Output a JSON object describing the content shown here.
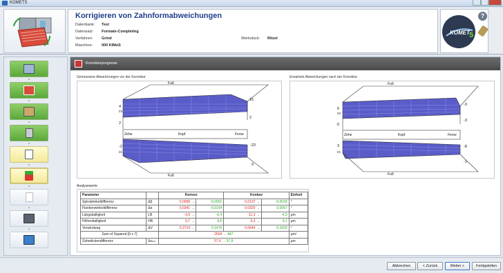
{
  "app": {
    "title": "KOMETS"
  },
  "header": {
    "title": "Korrigieren von Zahnformabweichungen",
    "rows": [
      {
        "label": "Datenbank:",
        "value": "Test"
      },
      {
        "label": "Datensatz:",
        "value": "Formate-Completing"
      },
      {
        "label": "Verfahren:",
        "value": "Grind"
      },
      {
        "label": "Maschine:",
        "value": "000 KIMoS"
      }
    ],
    "werkstueck_label": "Werkstück:",
    "werkstueck_value": "Ritzel",
    "logo_text": "KOMET",
    "logo_num": "5"
  },
  "section": {
    "title": "Korrekturprognose"
  },
  "left_plot": {
    "title": "Gemessene Abweichungen vor der Korrektur",
    "fuss_top": "Fuß",
    "fuss_bottom": "Fuß",
    "zehe": "Zehe",
    "kopf": "Kopf",
    "ferse": "Ferse",
    "cv": "cv",
    "cc": "cc",
    "nums": {
      "top_left": "4",
      "top_right_a": "15",
      "top_right_b": "2",
      "mid_left": "2",
      "bot_right_a": "-23",
      "bot_right_b": "0",
      "bot_left": "-2"
    }
  },
  "right_plot": {
    "title": "Erwartete Abweichungen nach der Korrektur",
    "fuss_top": "Fuß",
    "fuss_bottom": "Fuß",
    "zehe": "Zehe",
    "kopf": "Kopf",
    "ferse": "Ferse",
    "cv": "cv",
    "cc": "cc",
    "nums": {
      "top_left": "6",
      "top_right_a": "-3",
      "top_right_b": "-3",
      "mid_left": "-3",
      "bot_right_a": "-8",
      "bot_right_b": "-1",
      "bot_left": "3"
    }
  },
  "analysis": {
    "title": "Analysewerte",
    "headers": {
      "param": "Parameter",
      "konvex": "Konvex",
      "konkav": "Konkav",
      "unit": "Einheit"
    },
    "arrow": "→",
    "rows": [
      {
        "param": "Spiralwinkeldifferenz",
        "sym": "Δβ",
        "kx_a": "0,0068",
        "kx_b": "-0,0001",
        "kk_a": "0,0137",
        "kk_b": "-0,0018",
        "unit": "°"
      },
      {
        "param": "Flankenwinkeldifferenz",
        "sym": "Δα",
        "kx_a": "0,0341",
        "kx_b": "-0,0154",
        "kk_a": "0,0320",
        "kk_b": "0,0067",
        "unit": "°"
      },
      {
        "param": "Längsballigkeit",
        "sym": "LB",
        "kx_a": "-3,9",
        "kx_b": "-6,4",
        "kk_a": "-11,3",
        "kk_b": "-4,3",
        "unit": "μm"
      },
      {
        "param": "Höhenballigkeit",
        "sym": "HB",
        "kx_a": "9,7",
        "kx_b": "8,6",
        "kk_a": "6,3",
        "kk_b": "9,1",
        "unit": "μm"
      },
      {
        "param": "Verwindung",
        "sym": "ΔV",
        "kx_a": "0,2714",
        "kx_b": "0,1476",
        "kk_a": "0,0644",
        "kk_b": "-0,1829",
        "unit": "°"
      }
    ],
    "sum_row": {
      "param": "Sum of Squared [9 x 7]",
      "a": "2604",
      "b": "947",
      "unit": "μm²"
    },
    "zahn_row": {
      "param": "Zahndickendifferenz",
      "sym": "Δsₘₙ",
      "a": "57,6",
      "b": "57,8",
      "unit": "μm"
    }
  },
  "footer": {
    "abbrechen": "Abbrechen",
    "zurueck": "< Zurück",
    "weiter": "Weiter >",
    "fertig": "Fertigstellen"
  }
}
